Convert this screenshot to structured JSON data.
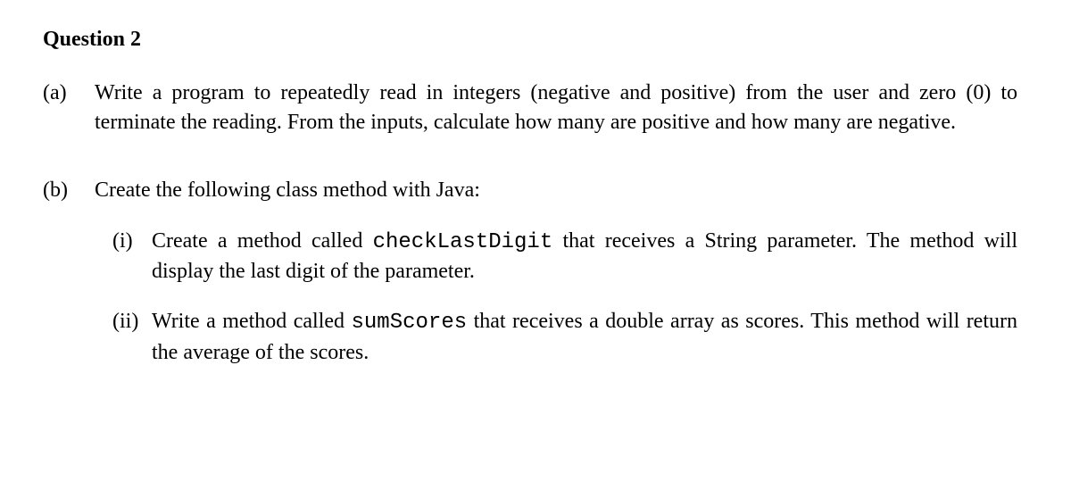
{
  "question_heading": "Question 2",
  "parts": {
    "a": {
      "label": "(a)",
      "text_before": "Write a program to repeatedly read in integers (negative and positive) from the user and zero (0) to terminate the reading.  From the inputs, calculate how many are positive and how many are negative."
    },
    "b": {
      "label": "(b)",
      "intro": "Create the following class method with Java:",
      "subs": {
        "i": {
          "label": "(i)",
          "seg1": "Create a method called ",
          "code": "checkLastDigit",
          "seg2": " that receives a String parameter. The method will display the last digit of the parameter."
        },
        "ii": {
          "label": "(ii)",
          "seg1": "Write a method called ",
          "code": "sumScores",
          "seg2": " that receives a double array as scores. This method will return the average of the scores."
        }
      }
    }
  }
}
